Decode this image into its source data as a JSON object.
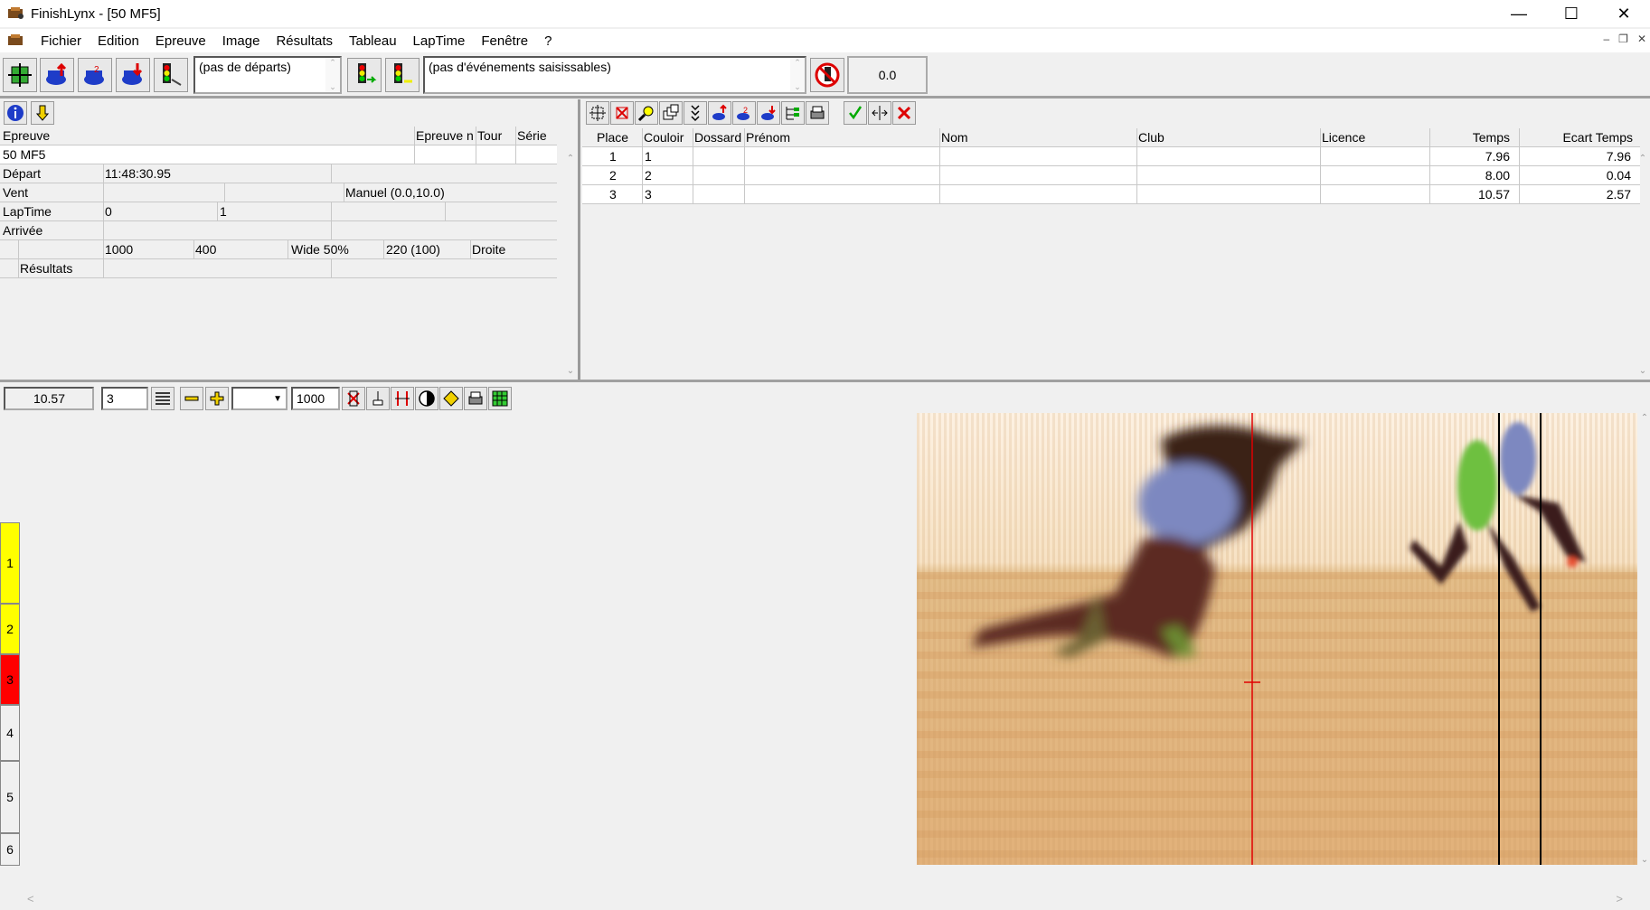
{
  "window": {
    "title": "FinishLynx - [50 MF5]"
  },
  "menu": [
    "Fichier",
    "Edition",
    "Epreuve",
    "Image",
    "Résultats",
    "Tableau",
    "LapTime",
    "Fenêtre",
    "?"
  ],
  "toolbar": {
    "starts_list": "(pas de départs)",
    "events_list": "(pas d'événements saisissables)",
    "wind_readout": "0.0"
  },
  "event_panel": {
    "headers": {
      "epreuve": "Epreuve",
      "epreuve_n": "Epreuve n",
      "tour": "Tour",
      "serie": "Série"
    },
    "epreuve_value": "50 MF5",
    "depart_label": "Départ",
    "depart_value": "11:48:30.95",
    "vent_label": "Vent",
    "vent_value": "Manuel (0.0,10.0)",
    "laptime_label": "LapTime",
    "laptime_a": "0",
    "laptime_b": "1",
    "arrivee_label": "Arrivée",
    "camera": {
      "a": "1000",
      "b": "400",
      "c": "Wide 50%",
      "d": "220  (100)",
      "e": "Droite"
    },
    "resultats_label": "Résultats"
  },
  "results": {
    "headers": {
      "place": "Place",
      "couloir": "Couloir",
      "dossard": "Dossard",
      "prenom": "Prénom",
      "nom": "Nom",
      "club": "Club",
      "licence": "Licence",
      "temps": "Temps",
      "ecart": "Ecart Temps"
    },
    "rows": [
      {
        "place": "1",
        "couloir": "1",
        "temps": "7.96",
        "ecart": "7.96"
      },
      {
        "place": "2",
        "couloir": "2",
        "temps": "8.00",
        "ecart": "0.04"
      },
      {
        "place": "3",
        "couloir": "3",
        "temps": "10.57",
        "ecart": "2.57"
      }
    ]
  },
  "image_bar": {
    "time": "10.57",
    "lane_input": "3",
    "density": "1000"
  },
  "lanes": [
    {
      "label": "1",
      "color": "#ffff00"
    },
    {
      "label": "2",
      "color": "#ffff00"
    },
    {
      "label": "3",
      "color": "#ff0000"
    },
    {
      "label": "4",
      "color": "#f0f0f0"
    },
    {
      "label": "5",
      "color": "#f0f0f0"
    },
    {
      "label": "6",
      "color": "#f0f0f0"
    }
  ]
}
